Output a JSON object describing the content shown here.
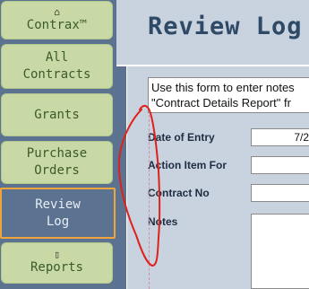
{
  "nav": {
    "items": [
      {
        "label": "Contrax™",
        "icon": "home-icon"
      },
      {
        "label": "All Contracts"
      },
      {
        "label": "Grants"
      },
      {
        "label": "Purchase Orders"
      },
      {
        "label": "Review Log",
        "active": true
      },
      {
        "label": "Reports",
        "icon": "document-icon"
      }
    ]
  },
  "page": {
    "title": "Review Log",
    "info_line1": "Use this form to enter notes",
    "info_line2": "\"Contract Details Report\" fr"
  },
  "form": {
    "date_label": "Date of Entry",
    "date_value": "7/2",
    "action_label": "Action Item For",
    "action_value": "",
    "contract_label": "Contract No",
    "contract_value": "",
    "notes_label": "Notes",
    "notes_value": ""
  },
  "colors": {
    "nav_bg": "#c9d9a6",
    "active_border": "#f2a43c",
    "title": "#2e4a66",
    "annotation": "#e0201a"
  }
}
